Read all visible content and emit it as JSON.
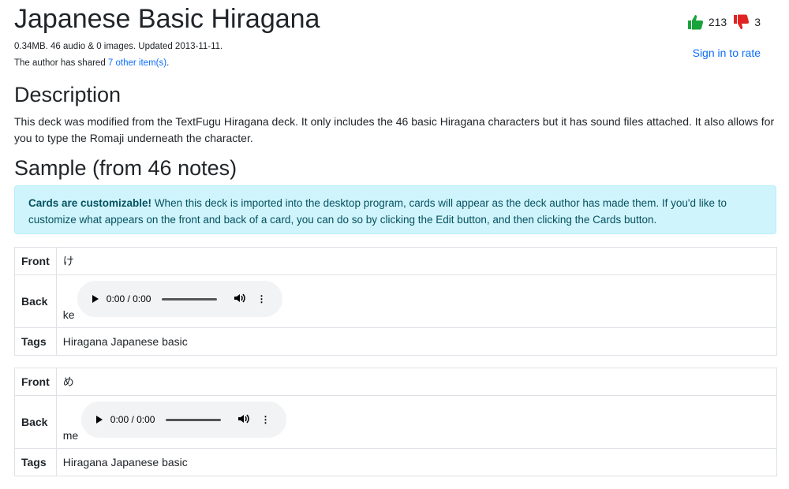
{
  "header": {
    "title": "Japanese Basic Hiragana",
    "meta_line": "0.34MB. 46 audio & 0 images. Updated 2013-11-11.",
    "shared_prefix": "The author has shared ",
    "shared_link": "7 other item(s)",
    "shared_suffix": "."
  },
  "rating": {
    "up_count": "213",
    "down_count": "3",
    "up_color": "#1aa33c",
    "down_color": "#e02424",
    "sign_in": "Sign in to rate"
  },
  "description": {
    "heading": "Description",
    "text": "This deck was modified from the TextFugu Hiragana deck. It only includes the 46 basic Hiragana characters but it has sound files attached. It also allows for you to type the Romaji underneath the character."
  },
  "sample": {
    "heading": "Sample (from 46 notes)",
    "alert_bold": "Cards are customizable!",
    "alert_text": " When this deck is imported into the desktop program, cards will appear as the deck author has made them. If you'd like to customize what appears on the front and back of a card, you can do so by clicking the Edit button, and then clicking the Cards button."
  },
  "cards": [
    {
      "front_label": "Front",
      "front": "け",
      "back_label": "Back",
      "audio_time": "0:00 / 0:00",
      "back": "ke",
      "tags_label": "Tags",
      "tags": "Hiragana Japanese basic"
    },
    {
      "front_label": "Front",
      "front": "め",
      "back_label": "Back",
      "audio_time": "0:00 / 0:00",
      "back": "me",
      "tags_label": "Tags",
      "tags": "Hiragana Japanese basic"
    }
  ]
}
